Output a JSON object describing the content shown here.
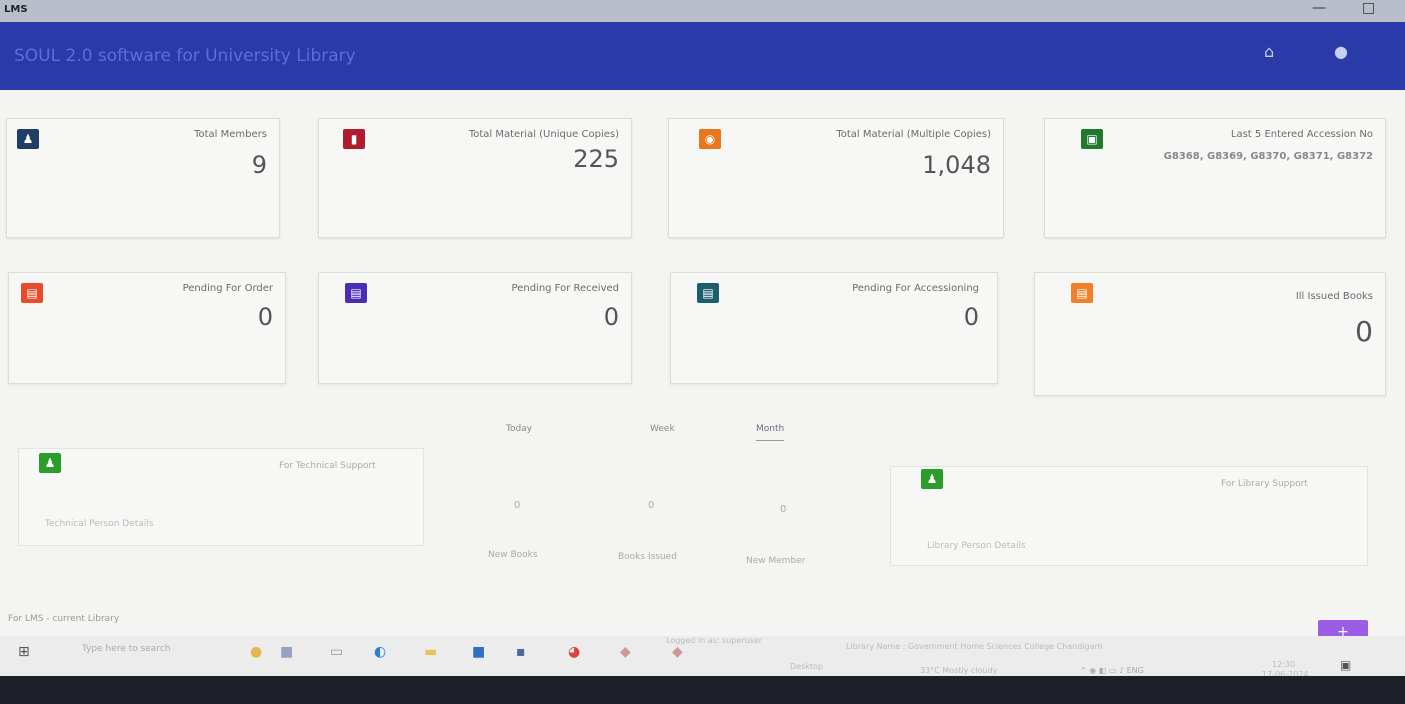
{
  "window": {
    "app_code": "LMS",
    "minimize": "—",
    "maximize": "□"
  },
  "header": {
    "title": "SOUL 2.0 software for University Library",
    "home_icon": "home-icon",
    "user_icon": "user-icon"
  },
  "stats_row1": [
    {
      "label": "Total Members",
      "value": "9",
      "color": "#1f3f66",
      "icon": "members-icon"
    },
    {
      "label": "Total Material (Unique Copies)",
      "value": "225",
      "color": "#b01c2e",
      "icon": "book-icon"
    },
    {
      "label": "Total Material (Multiple Copies)",
      "value": "1,048",
      "color": "#e8761d",
      "icon": "copies-icon"
    },
    {
      "label": "Last 5 Entered Accession No",
      "value": "G8368, G8369, G8370, G8371, G8372",
      "color": "#1f7a2e",
      "icon": "accession-icon"
    }
  ],
  "stats_row2": [
    {
      "label": "Pending For Order",
      "value": "0",
      "color": "#e84a2a",
      "icon": "order-icon"
    },
    {
      "label": "Pending For Received",
      "value": "0",
      "color": "#4a2db5",
      "icon": "received-icon"
    },
    {
      "label": "Pending For Accessioning",
      "value": "0",
      "color": "#1b5f6e",
      "icon": "accessioning-icon"
    },
    {
      "label": "Ill Issued Books",
      "value": "0",
      "color": "#f0802a",
      "icon": "issued-icon"
    }
  ],
  "technical_support": {
    "title": "For Technical Support",
    "footer": "Technical Person Details"
  },
  "library_support": {
    "title": "For Library Support",
    "footer": "Library Person Details"
  },
  "tabs": [
    {
      "label": "Today"
    },
    {
      "label": "Week"
    },
    {
      "label": "Month"
    }
  ],
  "summary": [
    {
      "value": "0",
      "label": "New Books"
    },
    {
      "value": "0",
      "label": "Books Issued"
    },
    {
      "value": "0",
      "label": "New Member"
    }
  ],
  "statusline": "For LMS - current Library",
  "chat_label": "+",
  "taskbar": {
    "search_placeholder": "Type here to search",
    "logged_in": "Logged in as: superuser",
    "library_name": "Library Name : Government Home Sciences College Chandigarh",
    "desktop": "Desktop",
    "weather": "33°C Mostly cloudy",
    "time": "12:30",
    "date": "17-06-2024"
  }
}
